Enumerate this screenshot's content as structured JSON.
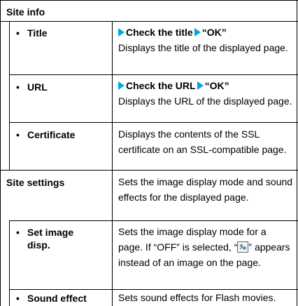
{
  "site_info": {
    "heading": "Site info",
    "title": {
      "bullet": "•",
      "label": "Title",
      "step_1": "Check the title",
      "step_2": "“OK”",
      "desc": "Displays the title of the displayed page."
    },
    "url": {
      "bullet": "•",
      "label": "URL",
      "step_1": "Check the URL",
      "step_2": "“OK”",
      "desc": "Displays the URL of the displayed page."
    },
    "certificate": {
      "bullet": "•",
      "label": "Certificate",
      "desc": "Displays the contents of the SSL certificate on an SSL-compatible page."
    }
  },
  "site_settings": {
    "heading": "Site settings",
    "desc": "Sets the image display mode and sound effects for the displayed page.",
    "set_image_disp": {
      "bullet": "•",
      "label_line_1": "Set image",
      "label_line_2": "disp.",
      "desc_part_1": "Sets the image display mode for a page. If “OFF” is selected, “",
      "icon": "image-placeholder-icon",
      "desc_part_2": "” appears instead of an image on the page."
    },
    "sound_effect": {
      "bullet": "•",
      "label": "Sound effect",
      "desc": "Sets sound effects for Flash movies."
    }
  },
  "colors": {
    "arrow": "#00a5e3",
    "border": "#000000"
  }
}
